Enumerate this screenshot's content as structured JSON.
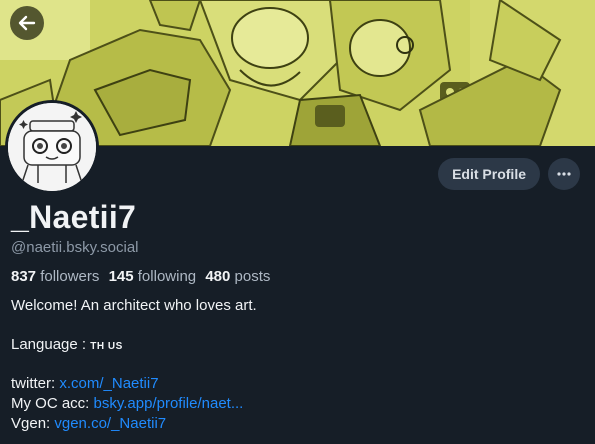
{
  "banner": {
    "tint": "#c9cf5f",
    "description_icon": "anime-robots-banner"
  },
  "nav": {
    "back_icon": "arrow-left-icon"
  },
  "profile": {
    "display_name": "_Naetii7",
    "handle": "@naetii.bsky.social",
    "followers_count": "837",
    "followers_label": "followers",
    "following_count": "145",
    "following_label": "following",
    "posts_count": "480",
    "posts_label": "posts"
  },
  "actions": {
    "edit_label": "Edit Profile",
    "more_icon": "ellipsis-icon"
  },
  "bio": {
    "welcome": "Welcome! An architect who loves art.",
    "language_label": "Language :",
    "language_flags": "TH US",
    "twitter_label": "twitter:",
    "twitter_link": "x.com/_Naetii7",
    "oc_label": "My OC acc:",
    "oc_link": "bsky.app/profile/naet...",
    "vgen_label": "Vgen:",
    "vgen_link": "vgen.co/_Naetii7"
  },
  "colors": {
    "background": "#161e27",
    "link": "#208bfe",
    "muted": "#8d99a7",
    "button": "#2c3847"
  }
}
